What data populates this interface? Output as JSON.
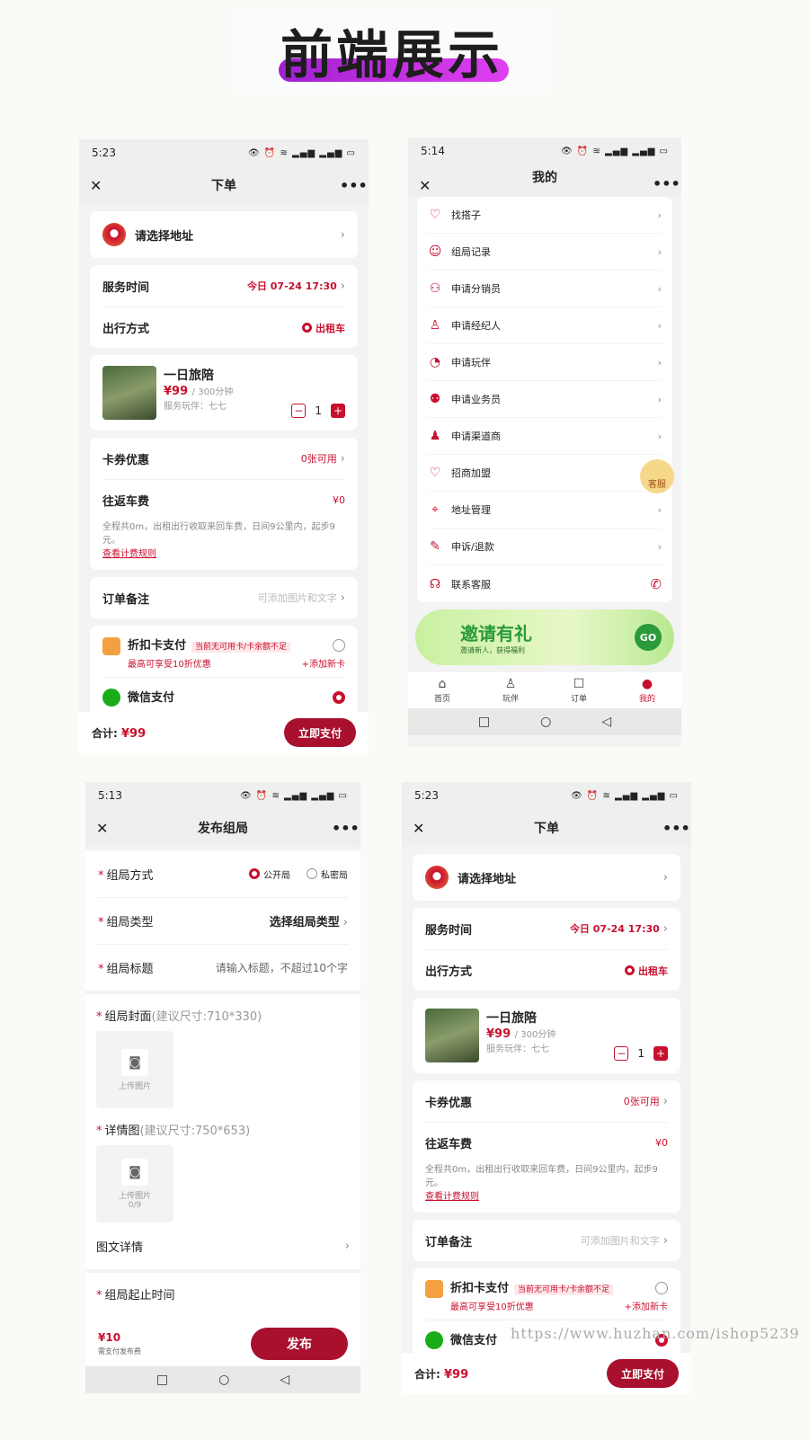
{
  "banner": {
    "title": "前端展示"
  },
  "status": {
    "icons": "👁 ⏰ ≋ ▂▄▆ ▂▄▆ ▭"
  },
  "orderA": {
    "time": "5:23",
    "title": "下单",
    "close": "✕",
    "more": "•••",
    "address": "请选择地址",
    "service_time_label": "服务时间",
    "service_time_value": "今日 07-24 17:30",
    "travel_label": "出行方式",
    "travel_value": "出租车",
    "goods_title": "一日旅陪",
    "goods_price": "¥99",
    "goods_unit": "/ 300分钟",
    "goods_player": "服务玩伴：七七",
    "qty": "1",
    "coupon_label": "卡券优惠",
    "coupon_value": "0张可用",
    "fare_label": "往返车费",
    "fare_value": "¥0",
    "fare_note": "全程共0m，出租出行收取来回车费，日间9公里内，起步9元。",
    "fare_link": "查看计费规则",
    "remark_label": "订单备注",
    "remark_value": "可添加图片和文字",
    "card_pay": "折扣卡支付",
    "card_tag": "当前无可用卡/卡余额不足",
    "card_sub": "最高可享受10折优惠",
    "card_add": "+添加新卡",
    "wechat_pay": "微信支付",
    "total_label": "合计:",
    "total_value": "¥99",
    "pay_btn": "立即支付"
  },
  "mine": {
    "time": "5:14",
    "title": "我的",
    "close": "✕",
    "more": "•••",
    "items": [
      {
        "label": "找搭子",
        "icon": "♡"
      },
      {
        "label": "组局记录",
        "icon": "☺"
      },
      {
        "label": "申请分销员",
        "icon": "⚇"
      },
      {
        "label": "申请经纪人",
        "icon": "♙"
      },
      {
        "label": "申请玩伴",
        "icon": "◔"
      },
      {
        "label": "申请业务员",
        "icon": "⚉"
      },
      {
        "label": "申请渠道商",
        "icon": "♟"
      },
      {
        "label": "招商加盟",
        "icon": "♡"
      },
      {
        "label": "地址管理",
        "icon": "⌖"
      },
      {
        "label": "申诉/退款",
        "icon": "✎"
      },
      {
        "label": "联系客服",
        "icon": "☊"
      }
    ],
    "kefu": "客服",
    "invite_title": "邀请有礼",
    "invite_sub": "邀请新人，获得福利",
    "invite_go": "GO",
    "tabs": [
      "首页",
      "玩伴",
      "订单",
      "我的"
    ]
  },
  "publish": {
    "time": "5:13",
    "title": "发布组局",
    "close": "✕",
    "more": "•••",
    "mode_label": "组局方式",
    "mode_public": "公开局",
    "mode_private": "私密局",
    "type_label": "组局类型",
    "type_value": "选择组局类型",
    "title_label": "组局标题",
    "title_placeholder": "请输入标题，不超过10个字",
    "cover_label": "组局封面",
    "cover_hint": "(建议尺寸:710*330)",
    "upload": "上传图片",
    "detail_label": "详情图",
    "detail_hint": "(建议尺寸:750*653)",
    "detail_count": "0/9",
    "rich_label": "图文详情",
    "period_label": "组局起止时间",
    "fee_value": "¥10",
    "fee_note": "需支付发布费",
    "publish_btn": "发布"
  },
  "sysnav": {
    "square": "□",
    "circle": "○",
    "back": "◁"
  },
  "watermark": "https://www.huzhan.com/ishop5239"
}
